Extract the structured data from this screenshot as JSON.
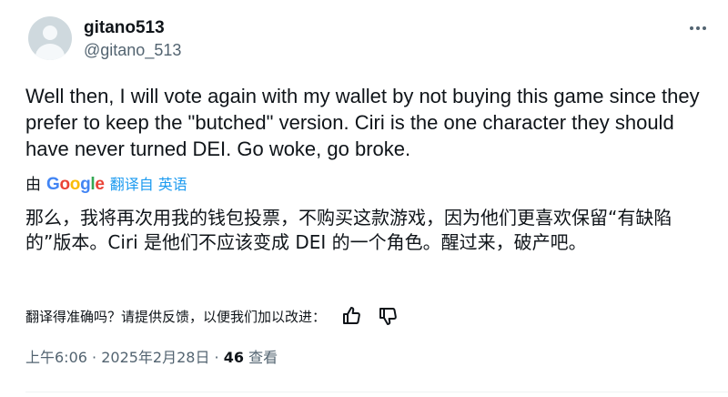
{
  "author": {
    "display_name": "gitano513",
    "handle": "@gitano_513"
  },
  "more_icon": "ellipsis-icon",
  "tweet": {
    "text": "Well then, I will vote again with my wallet by not buying this game since they prefer to keep the \"butched\" version. Ciri is the one character they should have never turned DEI. Go woke, go broke."
  },
  "translation": {
    "by_label": "由",
    "provider": "Google",
    "link_label": "翻译自 英语",
    "text": "那么，我将再次用我的钱包投票，不购买这款游戏，因为他们更喜欢保留“有缺陷的”版本。Ciri 是他们不应该变成 DEI 的一个角色。醒过来，破产吧。",
    "feedback_prompt": "翻译得准确吗？请提供反馈，以便我们加以改进：",
    "thumbs_up_icon": "thumbs-up-icon",
    "thumbs_down_icon": "thumbs-down-icon"
  },
  "meta": {
    "time": "上午6:06",
    "separator1": " · ",
    "date": "2025年2月28日",
    "separator2": " · ",
    "views_count": "46",
    "views_label": "查看"
  },
  "colors": {
    "link": "#1d9bf0",
    "secondary_text": "#536471",
    "primary_text": "#0f1419"
  }
}
